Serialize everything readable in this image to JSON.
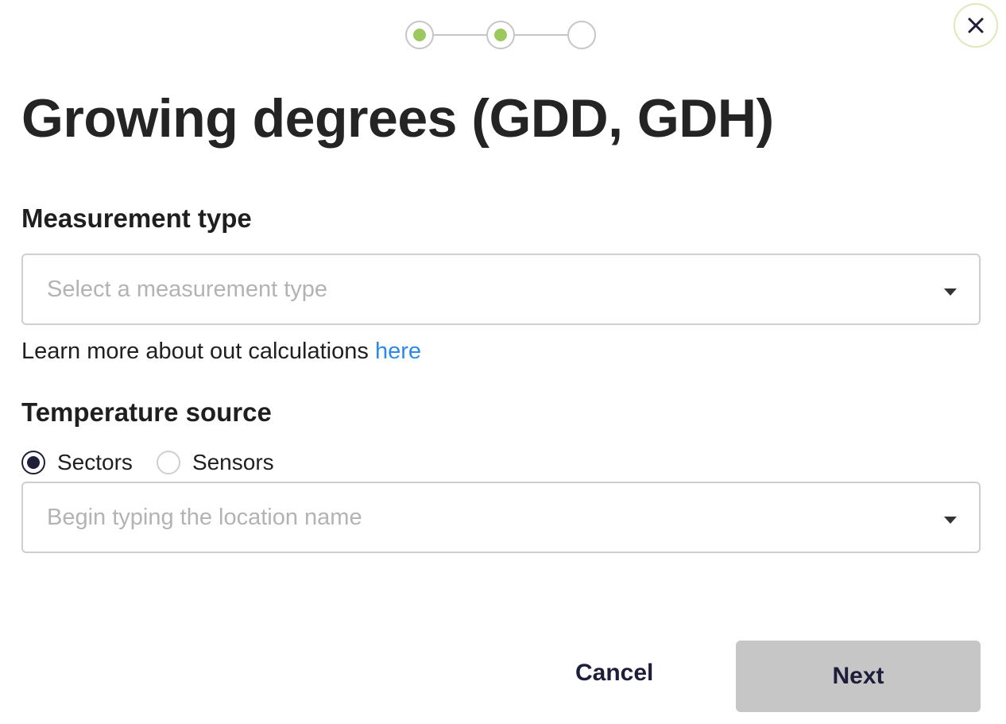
{
  "stepper": {
    "steps": [
      {
        "state": "completed"
      },
      {
        "state": "current"
      },
      {
        "state": "upcoming"
      }
    ],
    "colors": {
      "completed_dot": "#9cc95d",
      "ring": "#c6c6c6"
    }
  },
  "close": {
    "icon": "close-icon"
  },
  "title": "Growing degrees (GDD, GDH)",
  "measurement": {
    "label": "Measurement type",
    "placeholder": "Select a measurement type",
    "value": ""
  },
  "learn_more": {
    "text": "Learn more about out calculations ",
    "link_text": "here",
    "link_color": "#2d8ae5"
  },
  "temperature": {
    "label": "Temperature source",
    "options": [
      {
        "label": "Sectors",
        "checked": true
      },
      {
        "label": "Sensors",
        "checked": false
      }
    ],
    "location_placeholder": "Begin typing the location name",
    "location_value": ""
  },
  "actions": {
    "cancel_label": "Cancel",
    "next_label": "Next",
    "next_disabled": true
  }
}
